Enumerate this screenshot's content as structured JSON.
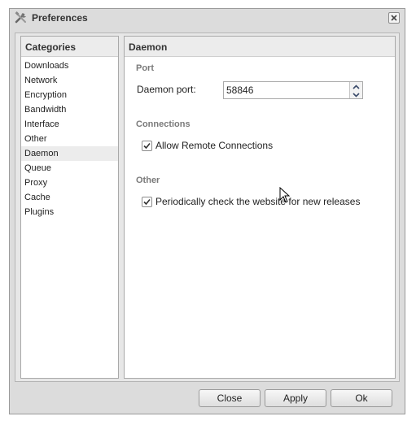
{
  "window": {
    "title": "Preferences"
  },
  "categories": {
    "header": "Categories",
    "items": [
      {
        "label": "Downloads"
      },
      {
        "label": "Network"
      },
      {
        "label": "Encryption"
      },
      {
        "label": "Bandwidth"
      },
      {
        "label": "Interface"
      },
      {
        "label": "Other"
      },
      {
        "label": "Daemon"
      },
      {
        "label": "Queue"
      },
      {
        "label": "Proxy"
      },
      {
        "label": "Cache"
      },
      {
        "label": "Plugins"
      }
    ],
    "selected": "Daemon"
  },
  "main": {
    "header": "Daemon",
    "port_section": "Port",
    "daemon_port_label": "Daemon port:",
    "daemon_port_value": "58846",
    "connections_section": "Connections",
    "allow_remote_label": "Allow Remote Connections",
    "allow_remote_checked": true,
    "other_section": "Other",
    "check_releases_label": "Periodically check the website for new releases",
    "check_releases_checked": true
  },
  "buttons": {
    "close": "Close",
    "apply": "Apply",
    "ok": "Ok"
  },
  "icons": {
    "app": "tools-icon",
    "close": "close-icon"
  }
}
